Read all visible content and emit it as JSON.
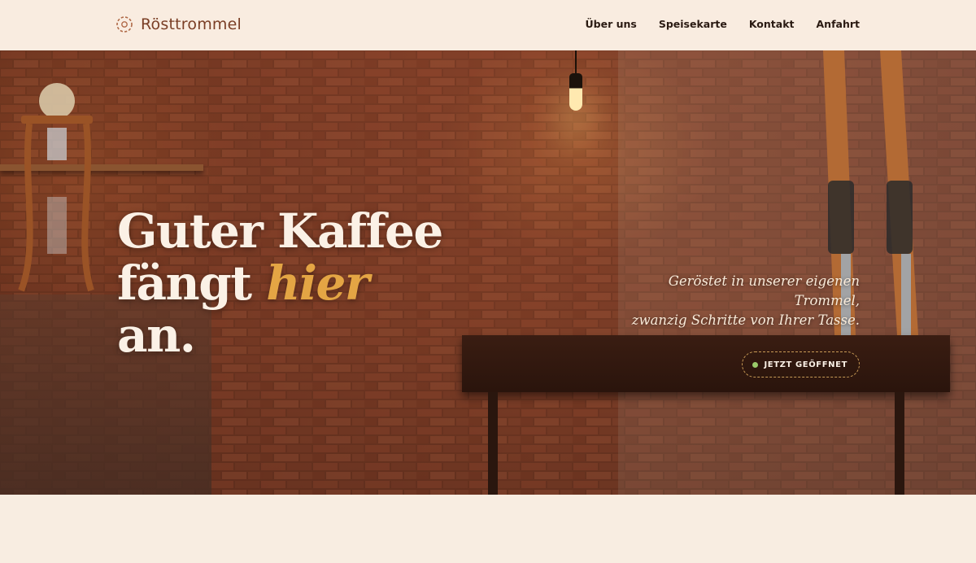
{
  "header": {
    "brand": "Rösttrommel",
    "nav": [
      "Über uns",
      "Speisekarte",
      "Kontakt",
      "Anfahrt"
    ]
  },
  "hero": {
    "headline_line1": "Guter Kaffee",
    "headline_line2_prefix": "fängt ",
    "headline_line2_accent": "hier",
    "headline_line3": "an.",
    "tagline_line1": "Geröstet in unserer eigenen",
    "tagline_line2": "Trommel,",
    "tagline_line3": "zwanzig Schritte von Ihrer Tasse.",
    "status_badge": "JETZT GEÖFFNET"
  },
  "colors": {
    "background": "#f8ede1",
    "brand": "#7a3e25",
    "accent": "#e4a544",
    "open_indicator": "#9acb6a"
  },
  "icons": {
    "logo": "coffee-drum-icon",
    "status": "status-dot-icon"
  }
}
